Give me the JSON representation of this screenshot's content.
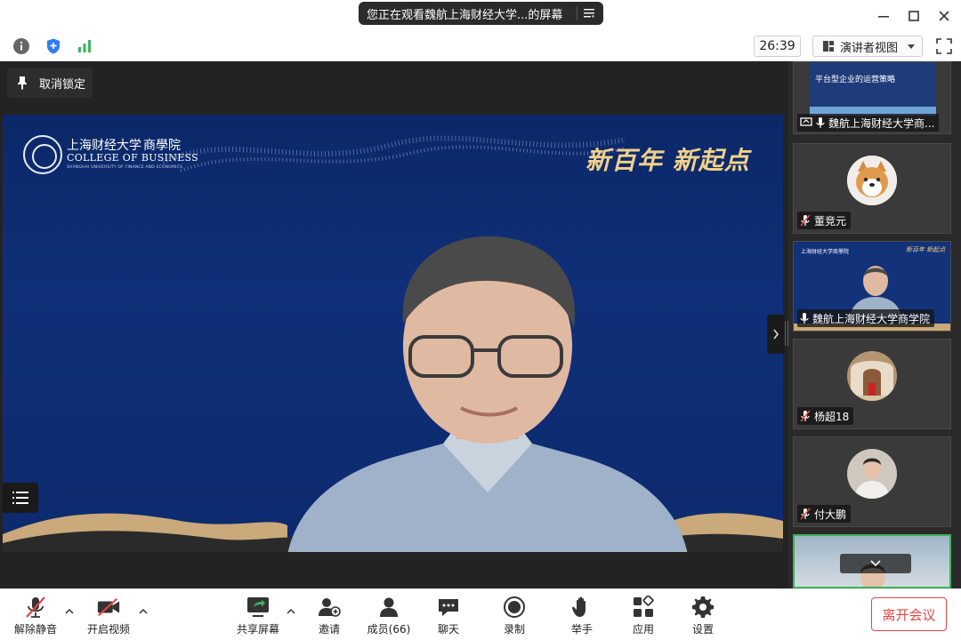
{
  "titlebar": {
    "share_banner": "您正在观看魏航上海财经大学...的屏幕",
    "icons": [
      "menu-icon",
      "minimize-icon",
      "maximize-icon",
      "close-icon"
    ]
  },
  "infobar": {
    "icons": [
      "info-icon",
      "shield-icon",
      "signal-icon"
    ],
    "timer": "26:39",
    "view_mode": "演讲者视图",
    "accent": "#2f7cf6",
    "signal_color": "#3db35b"
  },
  "stage": {
    "pin_label": "取消锁定",
    "slide": {
      "logo_cn": "上海财经大学",
      "logo_cn_school": "商學院",
      "logo_en": "COLLEGE OF BUSINESS",
      "logo_sub": "SHANGHAI UNIVERSITY OF FINANCE AND ECONOMICS",
      "slogan": "新百年 新起点",
      "bg_color": "#0f2f78",
      "slogan_color": "#f3d189"
    }
  },
  "sidebar": {
    "tiles": [
      {
        "name": "魏航上海财经大学商...",
        "type": "screen",
        "slide_title": "平台型企业的运营策略",
        "mic": "on"
      },
      {
        "name": "董竞元",
        "type": "avatar",
        "mic": "muted",
        "avatar": "dog"
      },
      {
        "name": "魏航上海财经大学商学院",
        "type": "video",
        "mic": "on"
      },
      {
        "name": "杨超18",
        "type": "avatar",
        "mic": "muted",
        "avatar": "building"
      },
      {
        "name": "付大鹏",
        "type": "avatar",
        "mic": "muted",
        "avatar": "person"
      },
      {
        "name": "",
        "type": "video-active",
        "mic": "on"
      }
    ],
    "muted_color": "#e54545"
  },
  "bottombar": {
    "items": [
      {
        "label": "解除静音",
        "icon": "mic-muted-icon"
      },
      {
        "label": "开启视频",
        "icon": "camera-off-icon"
      },
      {
        "label": "共享屏幕",
        "icon": "share-screen-icon"
      },
      {
        "label": "邀请",
        "icon": "invite-icon"
      },
      {
        "label": "成员(66)",
        "icon": "members-icon"
      },
      {
        "label": "聊天",
        "icon": "chat-icon"
      },
      {
        "label": "录制",
        "icon": "record-icon"
      },
      {
        "label": "举手",
        "icon": "raise-hand-icon"
      },
      {
        "label": "应用",
        "icon": "apps-icon"
      },
      {
        "label": "设置",
        "icon": "settings-icon"
      }
    ],
    "leave_label": "离开会议",
    "leave_color": "#e54545"
  }
}
